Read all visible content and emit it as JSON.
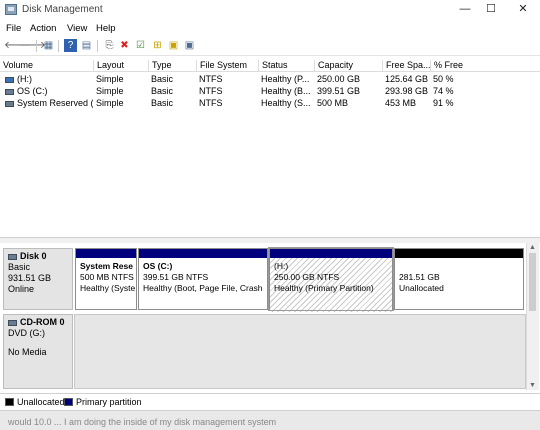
{
  "window": {
    "title": "Disk Management",
    "minimize": "—",
    "maximize": "☐",
    "close": "✕"
  },
  "menu": {
    "file": "File",
    "action": "Action",
    "view": "View",
    "help": "Help"
  },
  "toolbar": {
    "back": "🡐",
    "forward": "🡒",
    "refresh": "▦",
    "help": "?",
    "properties": "▤",
    "connect": "⎘",
    "delete": "✖",
    "check": "☑",
    "open": "⊞",
    "explore": "▣"
  },
  "volumes": {
    "headers": [
      "Volume",
      "Layout",
      "Type",
      "File System",
      "Status",
      "Capacity",
      "Free Spa...",
      "% Free"
    ],
    "rows": [
      [
        "(H:)",
        "Simple",
        "Basic",
        "NTFS",
        "Healthy (P...",
        "250.00 GB",
        "125.64 GB",
        "50 %"
      ],
      [
        "OS (C:)",
        "Simple",
        "Basic",
        "NTFS",
        "Healthy (B...",
        "399.51 GB",
        "293.98 GB",
        "74 %"
      ],
      [
        "System Reserved (...",
        "Simple",
        "Basic",
        "NTFS",
        "Healthy (S...",
        "500 MB",
        "453 MB",
        "91 %"
      ]
    ]
  },
  "disks": {
    "disk0": {
      "name": "Disk 0",
      "type": "Basic",
      "size": "931.51 GB",
      "status": "Online",
      "partitions": [
        {
          "name": "System Rese",
          "detail": "500 MB NTFS",
          "status": "Healthy (Syste"
        },
        {
          "name": "OS  (C:)",
          "detail": "399.51 GB NTFS",
          "status": "Healthy (Boot, Page File, Crash"
        },
        {
          "name": "(H:)",
          "detail": "250.00 GB NTFS",
          "status": "Healthy (Primary Partition)"
        },
        {
          "name": "",
          "detail": "281.51 GB",
          "status": "Unallocated"
        }
      ]
    },
    "cdrom0": {
      "name": "CD-ROM 0",
      "type": "DVD (G:)",
      "status": "No Media"
    }
  },
  "legend": {
    "unallocated": "Unallocated",
    "primary": "Primary partition"
  },
  "colors": {
    "primary": "#00007f",
    "unallocated": "#000000"
  },
  "bottom_text": "would 10.0 ... I am doing the inside of my disk management system"
}
